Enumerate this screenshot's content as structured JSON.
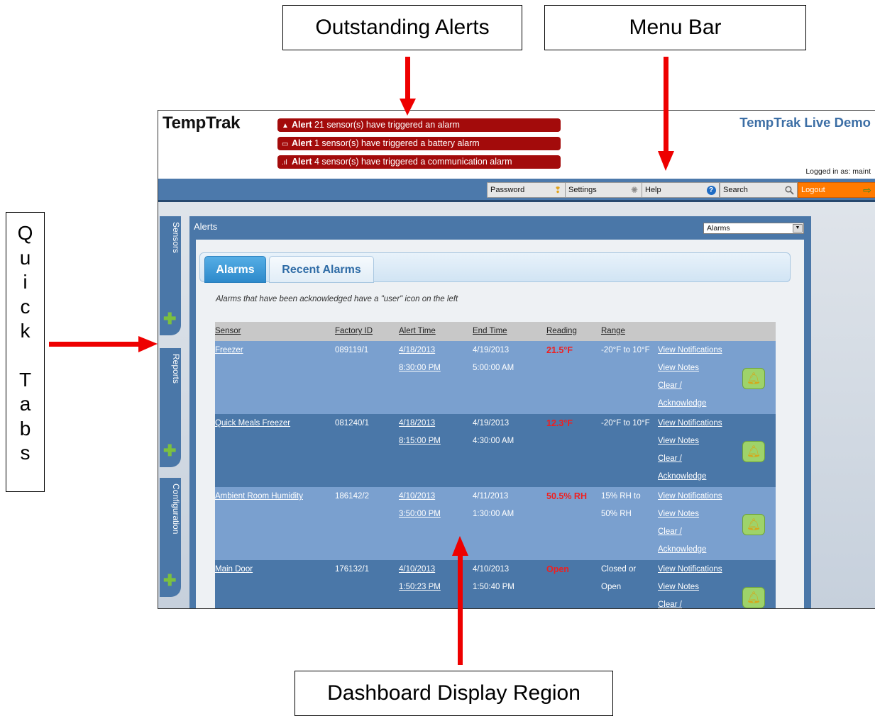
{
  "callouts": {
    "outstanding_alerts": "Outstanding Alerts",
    "menu_bar": "Menu Bar",
    "dashboard_display_region": "Dashboard Display Region",
    "quick_tabs_letters": [
      "Q",
      "u",
      "i",
      "c",
      "k",
      "",
      "T",
      "a",
      "b",
      "s"
    ]
  },
  "app": {
    "logo": "TempTrak",
    "site_title": "TempTrak Live Demo",
    "logged_in": "Logged in as: maint",
    "alerts": [
      {
        "icon": "warning-icon",
        "bold": "Alert",
        "text": "21 sensor(s) have triggered an alarm"
      },
      {
        "icon": "battery-icon",
        "bold": "Alert",
        "text": "1 sensor(s) have triggered a battery alarm"
      },
      {
        "icon": "signal-icon",
        "bold": "Alert",
        "text": "4 sensor(s) have triggered a communication alarm"
      }
    ],
    "menu": {
      "password": "Password",
      "settings": "Settings",
      "help": "Help",
      "search": "Search",
      "logout": "Logout"
    },
    "quick_tabs": {
      "sensors": "Sensors",
      "reports": "Reports",
      "configuration": "Configuration"
    },
    "dashboard": {
      "title": "Alerts",
      "select_value": "Alarms",
      "tabs": {
        "alarms": "Alarms",
        "recent_alarms": "Recent Alarms"
      },
      "note": "Alarms that have been acknowledged have a \"user\" icon on the left",
      "columns": {
        "sensor": "Sensor",
        "factory_id": "Factory ID",
        "alert_time": "Alert Time",
        "end_time": "End Time",
        "reading": "Reading",
        "range": "Range"
      },
      "actions": {
        "view_notifications": "View Notifications",
        "view_notes": "View Notes",
        "clear": "Clear /",
        "acknowledge": "Acknowledge"
      },
      "rows": [
        {
          "sensor": "Freezer",
          "factory_id": "089119/1",
          "alert_date": "4/18/2013",
          "alert_clock": "8:30:00 PM",
          "end_date": "4/19/2013",
          "end_clock": "5:00:00 AM",
          "reading": "21.5°F",
          "range_1": "-20°F to 10°F",
          "range_2": ""
        },
        {
          "sensor": "Quick Meals Freezer",
          "factory_id": "081240/1",
          "alert_date": "4/18/2013",
          "alert_clock": "8:15:00 PM",
          "end_date": "4/19/2013",
          "end_clock": "4:30:00 AM",
          "reading": "12.3°F",
          "range_1": "-20°F to 10°F",
          "range_2": ""
        },
        {
          "sensor": "Ambient Room Humidity",
          "factory_id": "186142/2",
          "alert_date": "4/10/2013",
          "alert_clock": "3:50:00 PM",
          "end_date": "4/11/2013",
          "end_clock": "1:30:00 AM",
          "reading": "50.5% RH",
          "range_1": "15% RH to",
          "range_2": "50% RH"
        },
        {
          "sensor": "Main Door",
          "factory_id": "176132/1",
          "alert_date": "4/10/2013",
          "alert_clock": "1:50:23 PM",
          "end_date": "4/10/2013",
          "end_clock": "1:50:40 PM",
          "reading": "Open",
          "range_1": "Closed or",
          "range_2": "Open"
        }
      ]
    }
  }
}
